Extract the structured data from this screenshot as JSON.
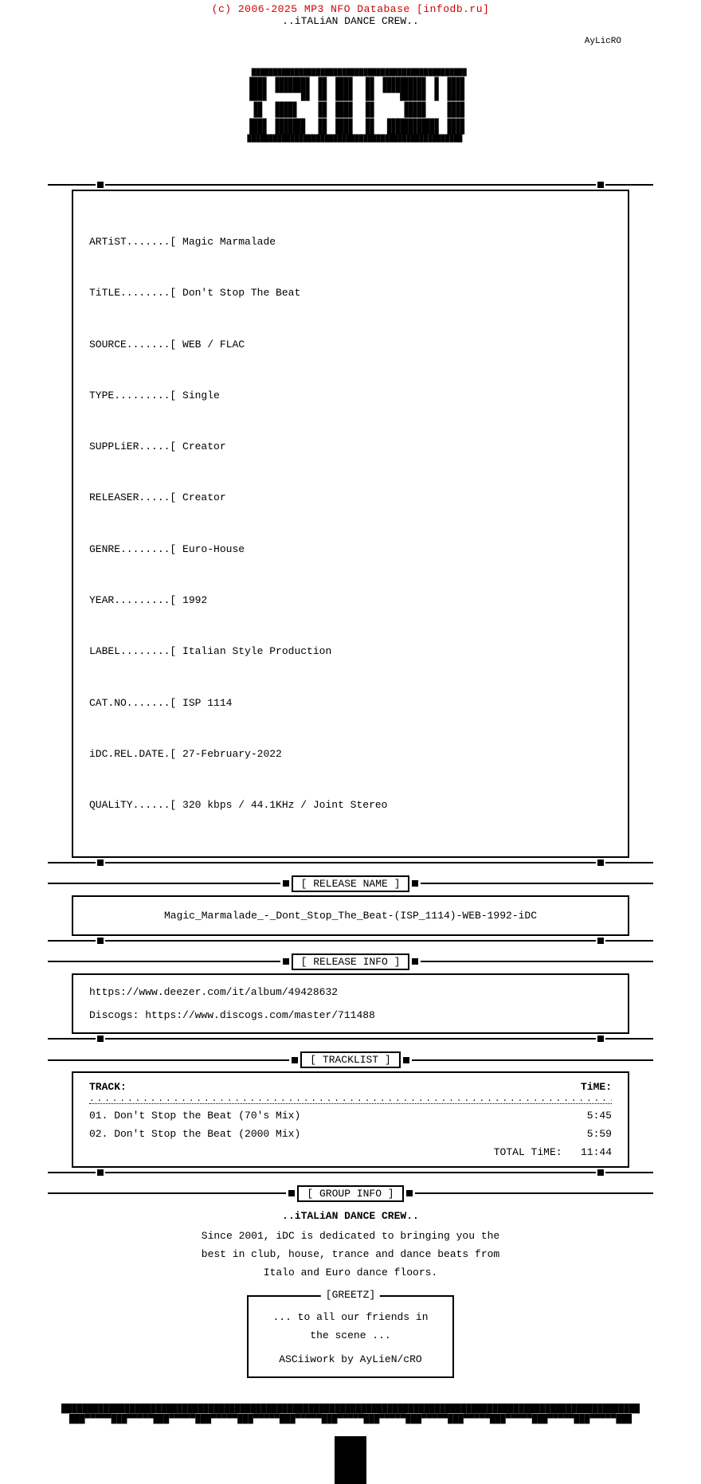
{
  "header": {
    "credit": "(c) 2006-2025 MP3 NFO Database [infodb.ru]",
    "subtitle": "..iTALiAN DANCE CREW.."
  },
  "logo_attribution": "AyLicRO",
  "info": {
    "artist_label": "ARTiST.......[",
    "artist_value": "Magic Marmalade",
    "title_label": "TiTLE........[",
    "title_value": "Don't Stop The Beat",
    "source_label": "SOURCE.......[",
    "source_value": "WEB / FLAC",
    "type_label": "TYPE.........[",
    "type_value": "Single",
    "supplier_label": "SUPPLiER.....[",
    "supplier_value": "Creator",
    "releaser_label": "RELEASER.....[",
    "releaser_value": "Creator",
    "genre_label": "GENRE........[",
    "genre_value": "Euro-House",
    "year_label": "YEAR.........[",
    "year_value": "1992",
    "label_label": "LABEL........[",
    "label_value": "Italian Style Production",
    "catno_label": "CAT.NO.......[",
    "catno_value": "ISP 1114",
    "reldate_label": "iDC.REL.DATE.[",
    "reldate_value": "27-February-2022",
    "quality_label": "QUALiTY......[",
    "quality_value": "320 kbps / 44.1KHz / Joint Stereo"
  },
  "sections": {
    "release_name_label": "[ RELEASE NAME ]",
    "release_name_value": "Magic_Marmalade_-_Dont_Stop_The_Beat-(ISP_1114)-WEB-1992-iDC",
    "release_info_label": "[ RELEASE INFO ]",
    "release_info_url1": "https://www.deezer.com/it/album/49428632",
    "release_info_url2": "Discogs: https://www.discogs.com/master/711488",
    "tracklist_label": "[ TRACKLIST ]",
    "tracklist_track_col": "TRACK:",
    "tracklist_time_col": "TiME:",
    "tracks": [
      {
        "num": "01.",
        "title": "Don't Stop the Beat (70's Mix)",
        "time": "5:45"
      },
      {
        "num": "02.",
        "title": "Don't Stop the Beat (2000 Mix)",
        "time": "5:59"
      }
    ],
    "total_time_label": "TOTAL TiME:",
    "total_time_value": "11:44",
    "group_info_label": "[ GROUP INFO ]",
    "group_name": "..iTALiAN DANCE CREW..",
    "group_description": "Since 2001, iDC is dedicated to bringing you the\nbest in club, house, trance and dance beats from\nItalo and Euro dance floors.",
    "greetz_label": "[GREETZ]",
    "greetz_line1": "... to all our friends in",
    "greetz_line2": "the scene ...",
    "greetz_line3": "",
    "ascii_credit": "ASCiiwork by AyLieN/cRO"
  }
}
